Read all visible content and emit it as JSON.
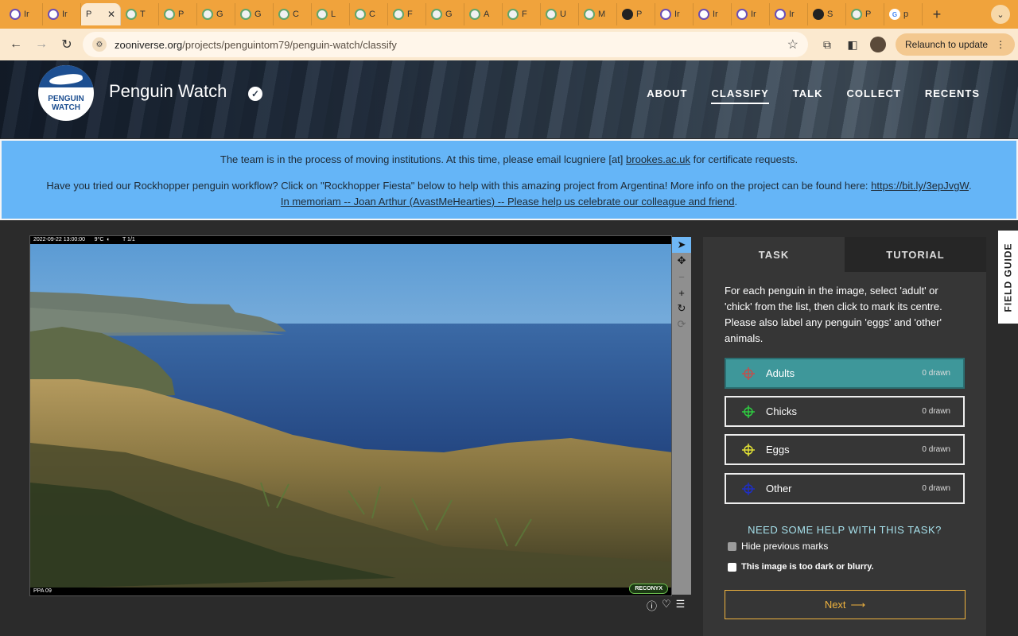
{
  "browser": {
    "tabs": [
      {
        "label": "Ir",
        "icon": "zooniverse-icon"
      },
      {
        "label": "Ir",
        "icon": "zooniverse-icon"
      },
      {
        "label": "P",
        "icon": "",
        "active": true
      },
      {
        "label": "T",
        "icon": "globe-icon"
      },
      {
        "label": "P",
        "icon": "globe-icon"
      },
      {
        "label": "G",
        "icon": "globe-icon"
      },
      {
        "label": "G",
        "icon": "globe-icon"
      },
      {
        "label": "C",
        "icon": "globe-icon"
      },
      {
        "label": "L",
        "icon": "globe-icon"
      },
      {
        "label": "C",
        "icon": "globe-icon"
      },
      {
        "label": "F",
        "icon": "globe-icon"
      },
      {
        "label": "G",
        "icon": "globe-icon"
      },
      {
        "label": "A",
        "icon": "globe-icon"
      },
      {
        "label": "F",
        "icon": "globe-icon"
      },
      {
        "label": "U",
        "icon": "globe-icon"
      },
      {
        "label": "M",
        "icon": "globe-icon"
      },
      {
        "label": "P",
        "icon": "dark-icon"
      },
      {
        "label": "Ir",
        "icon": "zooniverse-icon"
      },
      {
        "label": "Ir",
        "icon": "zooniverse-icon"
      },
      {
        "label": "Ir",
        "icon": "zooniverse-icon"
      },
      {
        "label": "Ir",
        "icon": "zooniverse-icon"
      },
      {
        "label": "S",
        "icon": "dark-icon"
      },
      {
        "label": "P",
        "icon": "globe-icon"
      },
      {
        "label": "p",
        "icon": "google-icon"
      }
    ],
    "new_tab": "+",
    "url_domain": "zooniverse.org",
    "url_path": "/projects/penguintom79/penguin-watch/classify",
    "relaunch_label": "Relaunch to update"
  },
  "header": {
    "logo_text_1": "PENGUIN",
    "logo_text_2": "WATCH",
    "title": "Penguin Watch",
    "nav": [
      {
        "label": "ABOUT"
      },
      {
        "label": "CLASSIFY",
        "active": true
      },
      {
        "label": "TALK"
      },
      {
        "label": "COLLECT"
      },
      {
        "label": "RECENTS"
      }
    ]
  },
  "announcement": {
    "line1_prefix": "The team is in the process of moving institutions. At this time, please email lcugniere [at] ",
    "line1_link": "brookes.ac.uk",
    "line1_suffix": " for certificate requests.",
    "line2_prefix": "Have you tried our Rockhopper penguin workflow? Click on \"Rockhopper Fiesta\" below to help with this amazing project from Argentina! More info on the project can be found here: ",
    "line2_link": "https://bit.ly/3epJvgW",
    "line2_suffix": ".",
    "line3_link": "In memoriam -- Joan Arthur (AvastMeHearties) -- Please help us celebrate our colleague and friend",
    "line3_suffix": "."
  },
  "subject": {
    "camera_info": "2022-09-22 13:00:00      9°C  ◐        T 1/1",
    "camera_id": "PPA 09",
    "brand": "RECONYX"
  },
  "task": {
    "tab_task": "TASK",
    "tab_tutorial": "TUTORIAL",
    "instructions": "For each penguin in the image, select 'adult' or 'chick' from the list, then click to mark its centre. Please also label any penguin 'eggs' and 'other' animals.",
    "choices": [
      {
        "label": "Adults",
        "count": "0 drawn",
        "color": "#c0504d"
      },
      {
        "label": "Chicks",
        "count": "0 drawn",
        "color": "#2ecc40"
      },
      {
        "label": "Eggs",
        "count": "0 drawn",
        "color": "#e0e035"
      },
      {
        "label": "Other",
        "count": "0 drawn",
        "color": "#1f2fc4"
      }
    ],
    "help_label": "NEED SOME HELP WITH THIS TASK?",
    "hide_marks_label": "Hide previous marks",
    "too_dark_label": "This image is too dark or blurry.",
    "next_label": "Next",
    "next_arrow": "⟶"
  },
  "field_guide_label": "FIELD GUIDE",
  "colors": {
    "tabbar": "#f0a33c",
    "announcement": "#65b5f7",
    "selected_choice": "#3e979a",
    "next_button": "#f0b33e"
  }
}
